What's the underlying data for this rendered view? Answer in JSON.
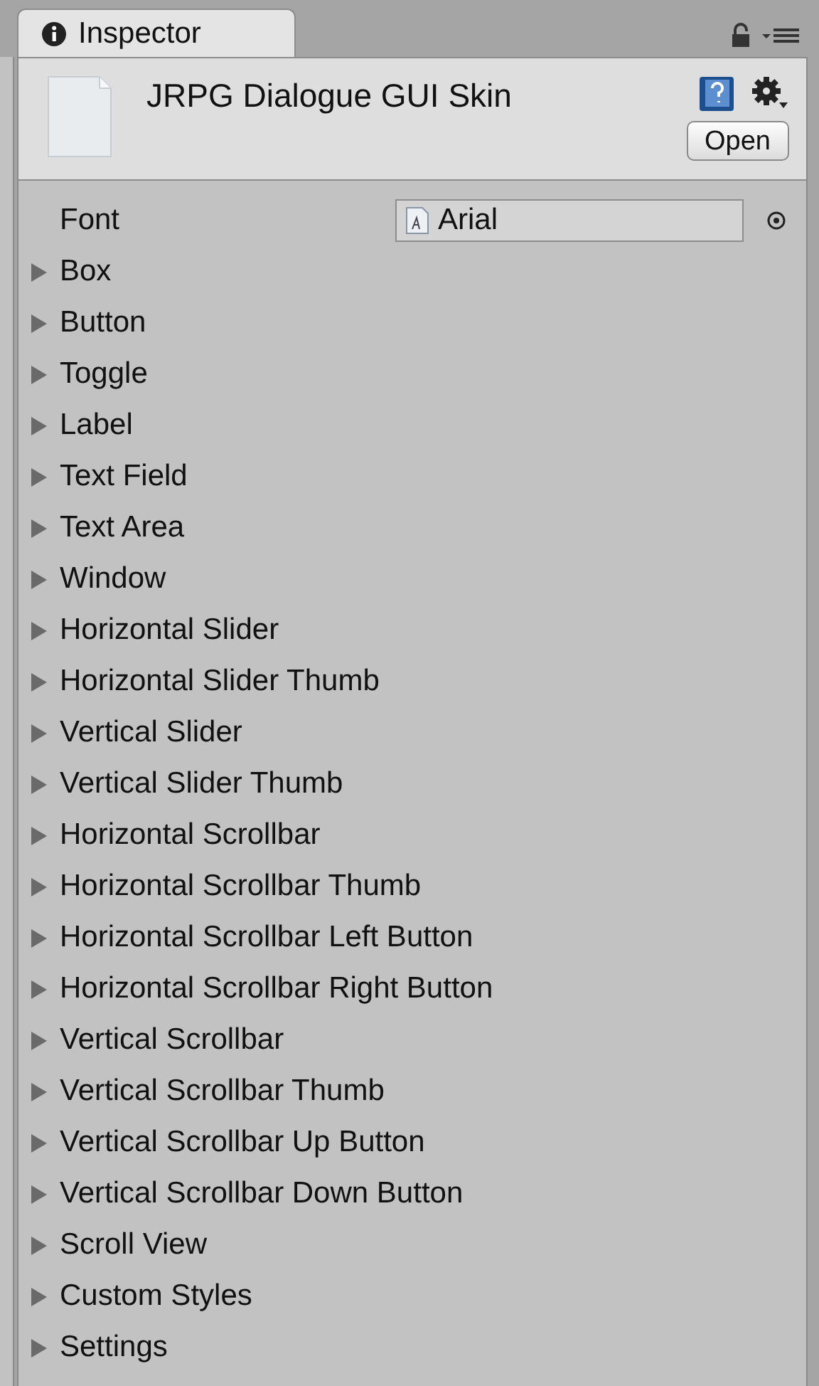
{
  "tab": {
    "title": "Inspector",
    "selected": true
  },
  "asset": {
    "name": "JRPG Dialogue GUI Skin",
    "open_button": "Open"
  },
  "font_field": {
    "label": "Font",
    "value": "Arial"
  },
  "styles": [
    {
      "label": "Box",
      "expanded": false
    },
    {
      "label": "Button",
      "expanded": false
    },
    {
      "label": "Toggle",
      "expanded": false
    },
    {
      "label": "Label",
      "expanded": false
    },
    {
      "label": "Text Field",
      "expanded": false
    },
    {
      "label": "Text Area",
      "expanded": false
    },
    {
      "label": "Window",
      "expanded": false
    },
    {
      "label": "Horizontal Slider",
      "expanded": false
    },
    {
      "label": "Horizontal Slider Thumb",
      "expanded": false
    },
    {
      "label": "Vertical Slider",
      "expanded": false
    },
    {
      "label": "Vertical Slider Thumb",
      "expanded": false
    },
    {
      "label": "Horizontal Scrollbar",
      "expanded": false
    },
    {
      "label": "Horizontal Scrollbar Thumb",
      "expanded": false
    },
    {
      "label": "Horizontal Scrollbar Left Button",
      "expanded": false
    },
    {
      "label": "Horizontal Scrollbar Right Button",
      "expanded": false
    },
    {
      "label": "Vertical Scrollbar",
      "expanded": false
    },
    {
      "label": "Vertical Scrollbar Thumb",
      "expanded": false
    },
    {
      "label": "Vertical Scrollbar Up Button",
      "expanded": false
    },
    {
      "label": "Vertical Scrollbar Down Button",
      "expanded": false
    },
    {
      "label": "Scroll View",
      "expanded": false
    },
    {
      "label": "Custom Styles",
      "expanded": false
    },
    {
      "label": "Settings",
      "expanded": false
    }
  ]
}
